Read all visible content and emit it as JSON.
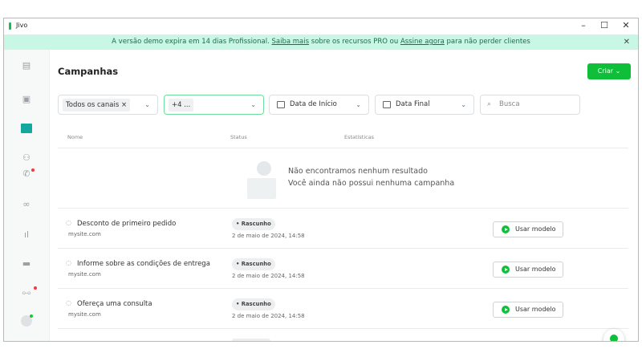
{
  "window": {
    "title": "Jivo",
    "minimize": "–",
    "maximize": "☐",
    "close": "✕"
  },
  "banner": {
    "text_before": "A versão demo expira em 14 dias Profissional. ",
    "link1": "Saiba mais",
    "text_middle": " sobre os recursos PRO ou ",
    "link2": "Assine agora",
    "text_after": " para não perder clientes",
    "close": "✕"
  },
  "sidebar": {
    "items": [
      "chats-icon",
      "contacts-icon",
      "campaigns-icon",
      "team-icon",
      "calls-icon",
      "monitoring-icon",
      "reports-icon",
      "billing-icon",
      "settings-icon",
      "profile-icon"
    ]
  },
  "page": {
    "title": "Campanhas",
    "create_label": "Criar",
    "create_chevron": "⌄"
  },
  "filters": {
    "channels_chip": "Todos os canais",
    "channels_remove": "×",
    "more_chip": "+4 ...",
    "start_date": "Data de Início",
    "end_date": "Data Final",
    "search_placeholder": "Busca",
    "chevron": "⌄"
  },
  "table": {
    "headers": [
      "Nome",
      "Status",
      "Estatísticas"
    ]
  },
  "empty": {
    "line1": "Não encontramos nenhum resultado",
    "line2": "Você ainda não possui nenhuma campanha"
  },
  "templates": [
    {
      "name": "Desconto de primeiro pedido",
      "site": "mysite.com",
      "status": "• Rascunho",
      "date": "2 de maio de 2024, 14:58",
      "action": "Usar modelo"
    },
    {
      "name": "Informe sobre as condições de entrega",
      "site": "mysite.com",
      "status": "• Rascunho",
      "date": "2 de maio de 2024, 14:58",
      "action": "Usar modelo"
    },
    {
      "name": "Ofereça uma consulta",
      "site": "mysite.com",
      "status": "• Rascunho",
      "date": "2 de maio de 2024, 14:58",
      "action": "Usar modelo"
    }
  ],
  "colors": {
    "accent": "#0fbf3a",
    "banner_bg": "#c8f7e6",
    "active_nav": "#13a89e"
  }
}
